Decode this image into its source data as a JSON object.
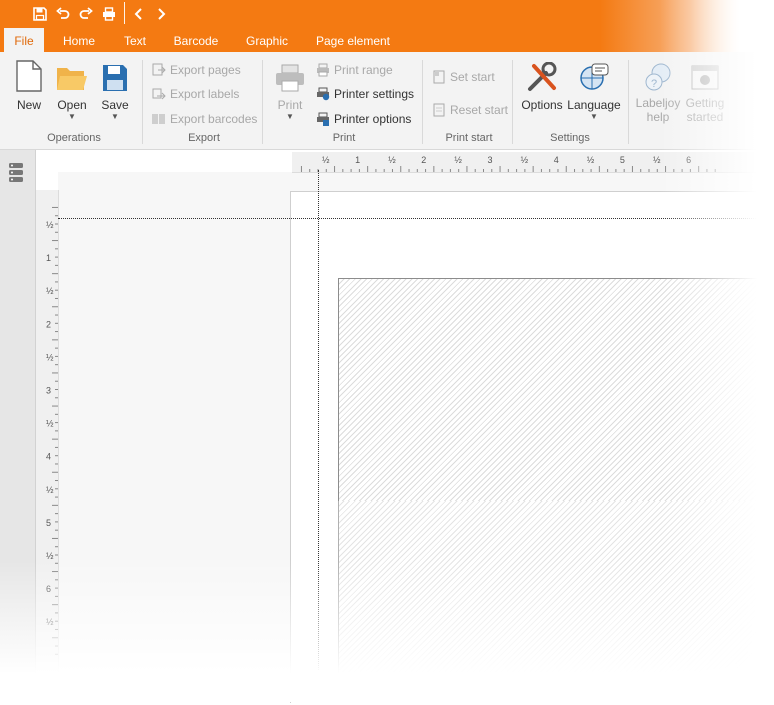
{
  "tabs": [
    "File",
    "Home",
    "Text",
    "Barcode",
    "Graphic",
    "Page element"
  ],
  "active_tab": "File",
  "ribbon": {
    "operations": {
      "group": "Operations",
      "new": "New",
      "open": "Open",
      "save": "Save"
    },
    "export": {
      "group": "Export",
      "pages": "Export pages",
      "labels": "Export labels",
      "barcodes": "Export barcodes"
    },
    "print": {
      "group": "Print",
      "print": "Print",
      "range": "Print range",
      "settings": "Printer settings",
      "options": "Printer options"
    },
    "print_start": {
      "group": "Print start",
      "set": "Set start",
      "reset": "Reset start"
    },
    "settings": {
      "group": "Settings",
      "options": "Options",
      "language": "Language"
    },
    "help": {
      "labeljoy_line1": "Labeljoy",
      "labeljoy_line2": "help",
      "getting_line1": "Getting",
      "getting_line2": "started"
    }
  },
  "ruler": {
    "horizontal": [
      "½",
      "1",
      "½",
      "2",
      "½",
      "3",
      "½",
      "4",
      "½",
      "5",
      "½",
      "6"
    ],
    "vertical": [
      "½",
      "1",
      "½",
      "2",
      "½",
      "3",
      "½",
      "4",
      "½",
      "5",
      "½",
      "6",
      "½"
    ]
  },
  "colors": {
    "accent": "#f47a12",
    "ribbon_bg": "#f3f3f3",
    "icon_blue": "#2a6fb0"
  }
}
